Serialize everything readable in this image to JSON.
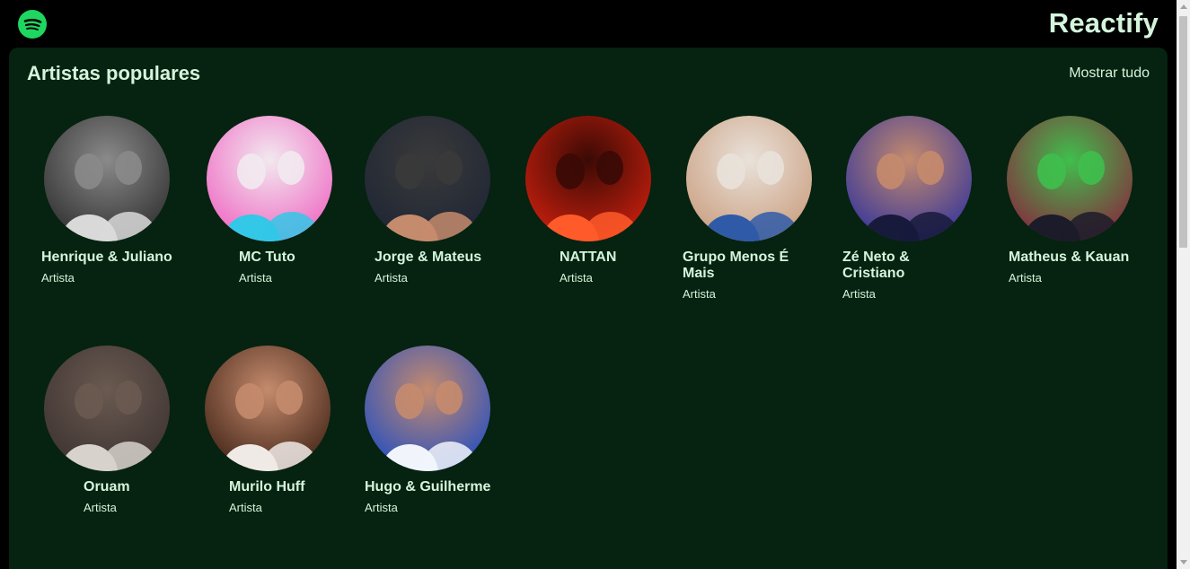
{
  "header": {
    "app_title": "Reactify",
    "logo_icon": "spotify-icon"
  },
  "section": {
    "title": "Artistas populares",
    "show_all_label": "Mostrar tudo"
  },
  "artists": [
    {
      "name": "Henrique & Juliano",
      "type": "Artista",
      "palette": [
        "#2a2a2a",
        "#d9d9d9",
        "#8a8a8a"
      ]
    },
    {
      "name": "MC Tuto",
      "type": "Artista",
      "palette": [
        "#ef5fc0",
        "#33c7e8",
        "#f2e9ef"
      ]
    },
    {
      "name": "Jorge & Mateus",
      "type": "Artista",
      "palette": [
        "#1c2434",
        "#c58b6d",
        "#3a3a3a"
      ]
    },
    {
      "name": "NATTAN",
      "type": "Artista",
      "palette": [
        "#d4210e",
        "#ff5a2a",
        "#3a0a05"
      ]
    },
    {
      "name": "Grupo Menos É Mais",
      "type": "Artista",
      "palette": [
        "#c89a7a",
        "#2f5aa8",
        "#e9e2da"
      ]
    },
    {
      "name": "Zé Neto & Cristiano",
      "type": "Artista",
      "palette": [
        "#2b2f9e",
        "#181a3c",
        "#c58b6d"
      ]
    },
    {
      "name": "Matheus & Kauan",
      "type": "Artista",
      "palette": [
        "#8c1e3c",
        "#1b1b2a",
        "#3fbf4c"
      ]
    },
    {
      "name": "Oruam",
      "type": "Artista",
      "palette": [
        "#3a3030",
        "#d7d2cc",
        "#6a5a50"
      ]
    },
    {
      "name": "Murilo Huff",
      "type": "Artista",
      "palette": [
        "#3a1e12",
        "#f0eae6",
        "#c58b6d"
      ]
    },
    {
      "name": "Hugo & Guilherme",
      "type": "Artista",
      "palette": [
        "#1a4ac6",
        "#f1f4fb",
        "#c58b6d"
      ]
    }
  ]
}
